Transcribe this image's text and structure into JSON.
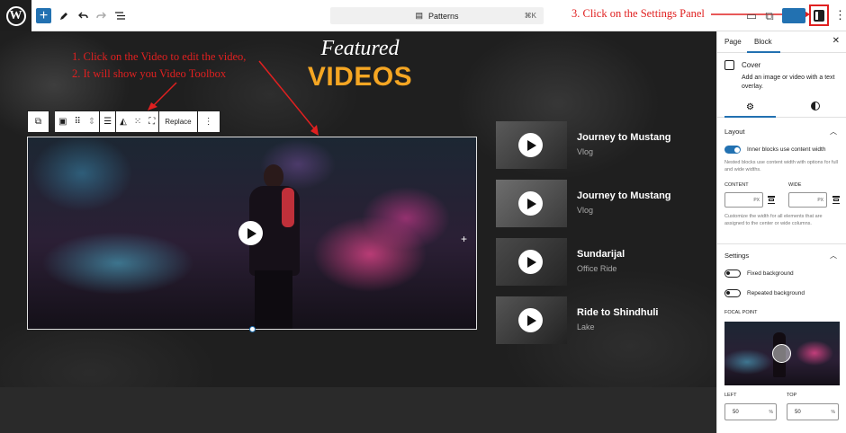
{
  "topbar": {
    "logo_letter": "W",
    "add_label": "+",
    "patterns_label": "Patterns",
    "patterns_shortcut": "⌘K",
    "annotation_settings": "3. Click on the Settings Panel"
  },
  "canvas": {
    "heading_script": "Featured",
    "heading_main": "VIDEOS",
    "annotation_line1": "1. Click on the Video to edit the video,",
    "annotation_line2": "2. It will show you Video Toolbox",
    "toolbar_replace": "Replace",
    "videos": [
      {
        "title": "Journey to Mustang",
        "subtitle": "Vlog"
      },
      {
        "title": "Journey to Mustang",
        "subtitle": "Vlog"
      },
      {
        "title": "Sundarijal",
        "subtitle": "Office Ride"
      },
      {
        "title": "Ride to Shindhuli",
        "subtitle": "Lake"
      }
    ]
  },
  "sidebar": {
    "tab_page": "Page",
    "tab_block": "Block",
    "block_name": "Cover",
    "block_desc": "Add an image or video with a text overlay.",
    "layout": {
      "title": "Layout",
      "inner_blocks_label": "Inner blocks use content width",
      "inner_blocks_on": true,
      "nested_note": "Nested blocks use content width with options for full and wide widths.",
      "content_label": "CONTENT",
      "wide_label": "WIDE",
      "content_unit": "PX",
      "wide_unit": "PX",
      "customize_note": "Customize the width for all elements that are assigned to the center or wide columns."
    },
    "settings": {
      "title": "Settings",
      "fixed_bg_label": "Fixed background",
      "repeated_bg_label": "Repeated background",
      "focal_label": "FOCAL POINT",
      "left_label": "LEFT",
      "top_label": "TOP",
      "left_value": "50",
      "top_value": "50",
      "percent": "%"
    }
  },
  "colors": {
    "accent": "#2271b1",
    "heading_orange": "#f5a623",
    "annotation_red": "#e02020"
  }
}
